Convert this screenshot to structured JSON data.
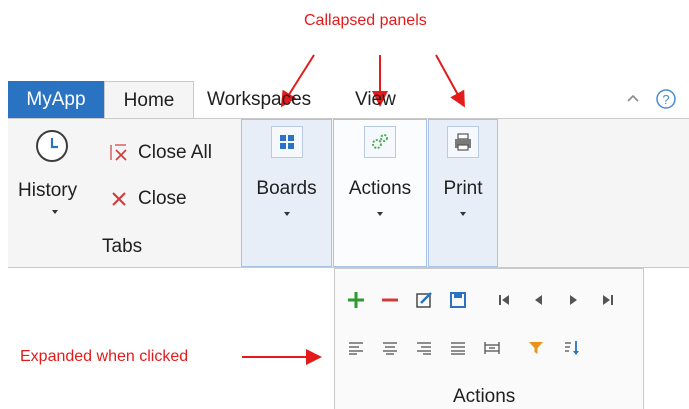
{
  "annotations": {
    "collapsed_panels": "Callapsed panels",
    "expanded_when_clicked": "Expanded when clicked"
  },
  "tabs": [
    {
      "label": "MyApp"
    },
    {
      "label": "Home"
    },
    {
      "label": "Workspaces"
    },
    {
      "label": "View"
    }
  ],
  "tabs_group": {
    "history_label": "History",
    "close_all_label": "Close All",
    "close_label": "Close",
    "group_label": "Tabs"
  },
  "collapsed_panels": [
    {
      "label": "Boards",
      "icon": "boards-icon"
    },
    {
      "label": "Actions",
      "icon": "actions-icon"
    },
    {
      "label": "Print",
      "icon": "print-icon"
    }
  ],
  "popup": {
    "label": "Actions",
    "row1_icons": [
      "add-icon",
      "remove-icon",
      "edit-icon",
      "save-icon",
      "first-icon",
      "previous-icon",
      "next-icon",
      "last-icon"
    ],
    "row2_icons": [
      "align-left-icon",
      "align-center-icon",
      "align-right-icon",
      "justify-icon",
      "distribute-icon",
      "filter-icon",
      "sort-icon"
    ]
  },
  "colors": {
    "app_tab": "#2a73c2",
    "annotation": "#e41b1b",
    "panel_highlight": "#e7eef8",
    "panel_border": "#a9c3e4"
  }
}
